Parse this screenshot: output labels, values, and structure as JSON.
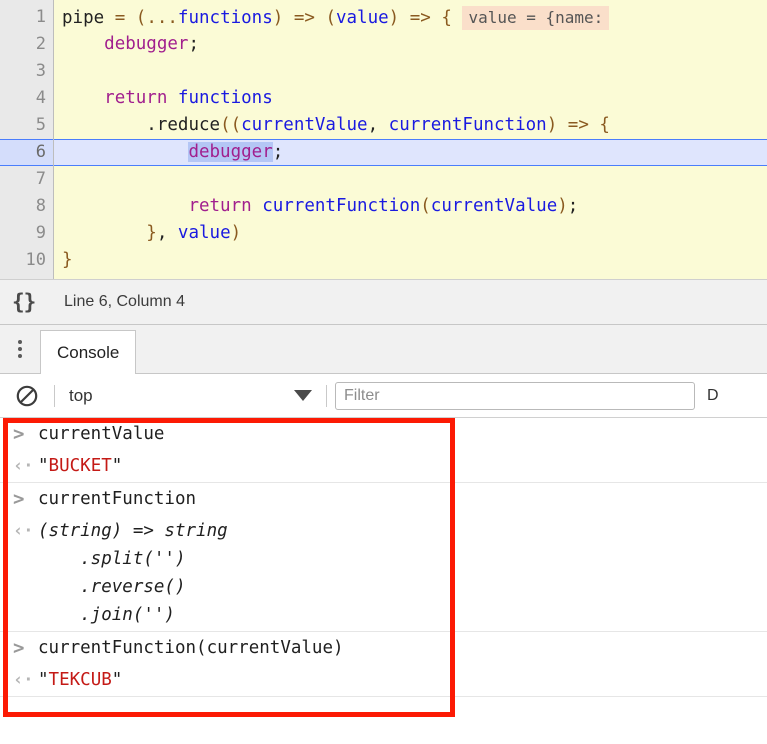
{
  "editor": {
    "line_numbers": [
      "1",
      "2",
      "3",
      "4",
      "5",
      "6",
      "7",
      "8",
      "9",
      "10"
    ],
    "active_line": 6,
    "inline_hint": "value = {name:",
    "lines": [
      {
        "n": 1,
        "raw": "pipe = (...functions) => (value) => {"
      },
      {
        "n": 2,
        "raw": "    debugger;"
      },
      {
        "n": 3,
        "raw": ""
      },
      {
        "n": 4,
        "raw": "    return functions"
      },
      {
        "n": 5,
        "raw": "        .reduce((currentValue, currentFunction) => {"
      },
      {
        "n": 6,
        "raw": "            debugger;"
      },
      {
        "n": 7,
        "raw": ""
      },
      {
        "n": 8,
        "raw": "            return currentFunction(currentValue);"
      },
      {
        "n": 9,
        "raw": "        }, value)"
      },
      {
        "n": 10,
        "raw": "}"
      }
    ]
  },
  "status_bar": {
    "pretty_print_icon": "{}",
    "cursor_position": "Line 6, Column 4"
  },
  "drawer": {
    "menu_icon": "kebab-menu-icon",
    "tabs": [
      {
        "label": "Console",
        "selected": true
      }
    ]
  },
  "console_toolbar": {
    "clear_icon": "clear-console-icon",
    "context": "top",
    "context_caret": "chevron-down-icon",
    "filter_placeholder": "Filter",
    "filter_value": "",
    "levels_label": "D"
  },
  "console_entries": [
    {
      "input_marker": ">",
      "input_text": "currentValue",
      "output_marker": "‹·",
      "output_parts": [
        {
          "text": "\"",
          "kind": "quote"
        },
        {
          "text": "BUCKET",
          "kind": "string"
        },
        {
          "text": "\"",
          "kind": "quote"
        }
      ],
      "output_italic": false
    },
    {
      "input_marker": ">",
      "input_text": "currentFunction",
      "output_marker": "‹·",
      "output_parts": [
        {
          "text": "(string) => string\n    .split('')\n    .reverse()\n    .join('')",
          "kind": "plain"
        }
      ],
      "output_italic": true
    },
    {
      "input_marker": ">",
      "input_text": "currentFunction(currentValue)",
      "output_marker": "‹·",
      "output_parts": [
        {
          "text": "\"",
          "kind": "quote"
        },
        {
          "text": "TEKCUB",
          "kind": "string"
        },
        {
          "text": "\"",
          "kind": "quote"
        }
      ],
      "output_italic": false
    }
  ],
  "annotation": {
    "shape": "rectangle",
    "color": "#fc1a04",
    "thickness_px": 5
  },
  "colors": {
    "editor_background": "#fbfbd6",
    "gutter_background": "#e9e9e9",
    "active_line_background": "#dfe5fd",
    "active_line_border": "#4a7dfc",
    "selection_background": "#b4c6f5",
    "inline_hint_background": "#fadfca",
    "keyword": "#a11f8e",
    "variable": "#1a1ae0",
    "operator": "#8a5a20",
    "string_value": "#c41a16",
    "annotation_red": "#fc1a04"
  }
}
